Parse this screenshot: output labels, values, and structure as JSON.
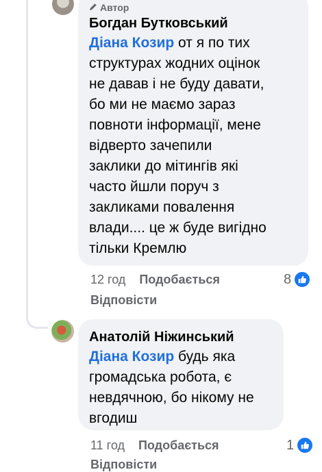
{
  "comment1": {
    "badge": "Автор",
    "name": "Богдан Бутковський",
    "mention": "Діана Козир",
    "text": " от я по тих\nструктурах жодних оцінок\nне давав і не буду давати,\nбо ми не маємо зараз\nповноти інформації, мене\nвідверто зачепили\nзаклики до мітингів які\nчасто йшли поруч з\nзакликами повалення\nвлади.... це ж буде вигідно\nтільки Кремлю",
    "time": "12 год",
    "like_label": "Подобається",
    "reply_label": "Відповісти",
    "reaction_count": "8"
  },
  "comment2": {
    "name": "Анатолій Ніжинський",
    "mention": "Діана Козир",
    "text": " будь яка\nгромадська робота,  є\nневдячною, бо нікому не\nвгодиш",
    "time": "11 год",
    "like_label": "Подобається",
    "reply_label": "Відповісти",
    "reaction_count": "1"
  },
  "colors": {
    "bubble": "#f0f2f5",
    "mention": "#216fdb",
    "meta": "#65676b",
    "like": "#1877f2"
  },
  "icons": {
    "author_badge": "pencil-icon",
    "reaction": "thumbs-up-icon"
  }
}
